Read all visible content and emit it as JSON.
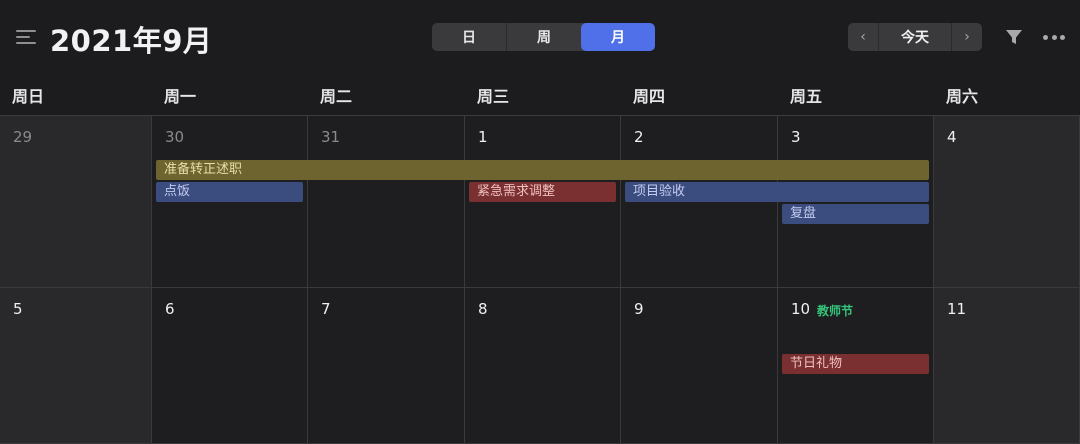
{
  "header": {
    "title": "2021年9月",
    "menu_icon": "menu-collapse-icon",
    "views": [
      {
        "label": "日",
        "active": false
      },
      {
        "label": "周",
        "active": false
      },
      {
        "label": "月",
        "active": true
      }
    ],
    "nav": {
      "prev": "‹",
      "today": "今天",
      "next": "›"
    },
    "filter_icon": "filter-icon",
    "more_icon": "more-icon"
  },
  "weekdays": [
    "周日",
    "周一",
    "周二",
    "周三",
    "周四",
    "周五",
    "周六"
  ],
  "weeks": [
    {
      "days": [
        {
          "num": "29",
          "muted": true,
          "holiday": ""
        },
        {
          "num": "30",
          "muted": true,
          "holiday": ""
        },
        {
          "num": "31",
          "muted": true,
          "holiday": ""
        },
        {
          "num": "1",
          "muted": false,
          "holiday": ""
        },
        {
          "num": "2",
          "muted": false,
          "holiday": ""
        },
        {
          "num": "3",
          "muted": false,
          "holiday": ""
        },
        {
          "num": "4",
          "muted": false,
          "holiday": ""
        }
      ],
      "events": [
        {
          "label": "准备转正述职",
          "color": "yellow",
          "start": 1,
          "span": 5,
          "lane": 0
        },
        {
          "label": "点饭",
          "color": "blue",
          "start": 1,
          "span": 1,
          "lane": 1
        },
        {
          "label": "紧急需求调整",
          "color": "red",
          "start": 3,
          "span": 1,
          "lane": 1
        },
        {
          "label": "项目验收",
          "color": "blue",
          "start": 4,
          "span": 2,
          "lane": 1
        },
        {
          "label": "复盘",
          "color": "blue",
          "start": 5,
          "span": 1,
          "lane": 2
        }
      ]
    },
    {
      "days": [
        {
          "num": "5",
          "muted": false,
          "holiday": ""
        },
        {
          "num": "6",
          "muted": false,
          "holiday": ""
        },
        {
          "num": "7",
          "muted": false,
          "holiday": ""
        },
        {
          "num": "8",
          "muted": false,
          "holiday": ""
        },
        {
          "num": "9",
          "muted": false,
          "holiday": ""
        },
        {
          "num": "10",
          "muted": false,
          "holiday": "教师节"
        },
        {
          "num": "11",
          "muted": false,
          "holiday": ""
        }
      ],
      "events": [
        {
          "label": "节日礼物",
          "color": "red",
          "start": 5,
          "span": 1,
          "lane": 1
        }
      ]
    }
  ],
  "colors": {
    "accent": "#4f70e8",
    "holiday_text": "#35c47a",
    "event_yellow": "#6d6430",
    "event_blue": "#3b4c7e",
    "event_red": "#7a2f30"
  }
}
